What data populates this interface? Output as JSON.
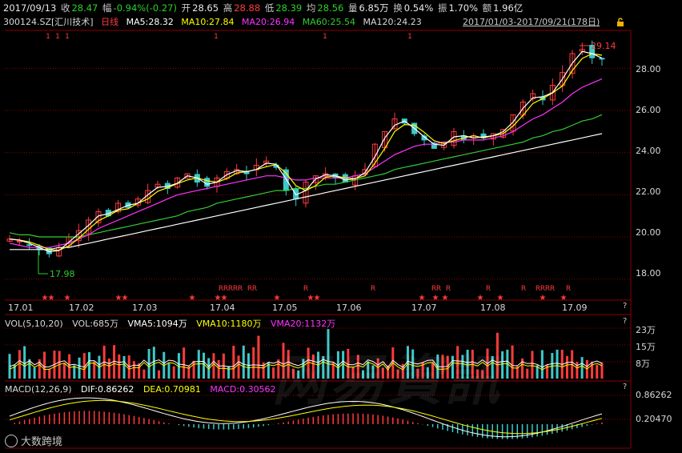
{
  "quote": {
    "date": "2017/09/13",
    "close_label": "收",
    "close": "28.47",
    "change_label": "幅",
    "change": "-0.94%(-0.27)",
    "open_label": "开",
    "open": "28.65",
    "high_label": "高",
    "high": "28.88",
    "low_label": "低",
    "low": "28.39",
    "avg_label": "均",
    "avg": "28.56",
    "volume_label": "量",
    "volume": "6.85万",
    "turnover_label": "换",
    "turnover": "0.54%",
    "amplitude_label": "振",
    "amplitude": "1.70%",
    "amount_label": "额",
    "amount": "1.96亿"
  },
  "info": {
    "code": "300124.SZ",
    "name": "[汇川技术]",
    "period": "日线",
    "ma5": "MA5:28.32",
    "ma10": "MA10:27.84",
    "ma20": "MA20:26.94",
    "ma60": "MA60:25.54",
    "ma120": "MA120:24.23",
    "date_range": "2017/01/03-2017/09/21(178日)"
  },
  "price_axis": [
    "28.00",
    "26.00",
    "24.00",
    "22.00",
    "20.00",
    "18.00"
  ],
  "annotations": {
    "high": "29.14",
    "low": "17.98"
  },
  "months": [
    "17.01",
    "17.02",
    "17.03",
    "17.04",
    "17.05",
    "17.06",
    "17.07",
    "17.08",
    "17.09"
  ],
  "volume": {
    "title": "VOL(5,10,20)",
    "vol": "VOL:685万",
    "vma5": "VMA5:1094万",
    "vma10": "VMA10:1180万",
    "vma20": "VMA20:1132万",
    "axis": [
      "23万",
      "15万",
      "8万"
    ],
    "help": "?"
  },
  "macd": {
    "title": "MACD(12,26,9)",
    "dif": "DIF:0.86262",
    "dea": "DEA:0.70981",
    "macd": "MACD:0.30562",
    "axis": [
      "0.86262",
      "0.20470"
    ],
    "help": "?"
  },
  "chart_help": "?",
  "brand": "大数跨境",
  "watermark": "网易資訊",
  "colors": {
    "up": "#ff3b3b",
    "down": "#3ec9c9",
    "ma5": "#ffffff",
    "ma10": "#ffff00",
    "ma20": "#ff33ff",
    "ma60": "#33cc33",
    "ma120": "#ffffff",
    "grid": "#8b0000"
  },
  "chart_data": {
    "type": "candlestick",
    "ylim": [
      17.0,
      29.8
    ],
    "closes": [
      19.9,
      19.8,
      19.6,
      19.4,
      19.2,
      19.5,
      20.0,
      20.3,
      20.8,
      21.2,
      21.0,
      21.6,
      21.4,
      21.8,
      22.2,
      22.5,
      22.3,
      22.8,
      23.0,
      22.6,
      22.4,
      22.8,
      23.1,
      23.2,
      23.0,
      23.4,
      23.6,
      23.3,
      22.2,
      21.8,
      22.6,
      22.9,
      23.0,
      22.8,
      22.6,
      22.9,
      23.2,
      24.4,
      25.0,
      25.6,
      25.4,
      24.9,
      24.6,
      24.2,
      24.5,
      25.0,
      24.6,
      24.8,
      24.7,
      24.9,
      25.1,
      25.8,
      26.4,
      26.8,
      26.5,
      27.2,
      27.8,
      28.7,
      28.9,
      28.5,
      28.47
    ],
    "ma20": [
      19.7,
      19.6,
      19.5,
      19.5,
      19.5,
      19.6,
      19.7,
      19.9,
      20.1,
      20.4,
      20.6,
      20.8,
      21.0,
      21.2,
      21.4,
      21.6,
      21.8,
      22.0,
      22.1,
      22.2,
      22.3,
      22.4,
      22.5,
      22.6,
      22.7,
      22.8,
      22.9,
      22.9,
      22.8,
      22.7,
      22.7,
      22.8,
      22.8,
      22.8,
      22.8,
      22.9,
      23.0,
      23.3,
      23.6,
      23.9,
      24.1,
      24.3,
      24.4,
      24.4,
      24.5,
      24.5,
      24.6,
      24.6,
      24.6,
      24.7,
      24.8,
      25.0,
      25.3,
      25.6,
      25.8,
      26.1,
      26.4,
      26.8,
      27.1,
      27.3,
      27.5
    ],
    "ma60": [
      20.2,
      20.1,
      20.1,
      20.0,
      20.0,
      20.0,
      20.0,
      20.0,
      20.1,
      20.2,
      20.3,
      20.4,
      20.5,
      20.6,
      20.7,
      20.8,
      20.9,
      21.0,
      21.2,
      21.3,
      21.4,
      21.6,
      21.7,
      21.8,
      21.9,
      22.0,
      22.1,
      22.2,
      22.2,
      22.3,
      22.3,
      22.4,
      22.5,
      22.5,
      22.6,
      22.7,
      22.8,
      22.9,
      23.0,
      23.2,
      23.3,
      23.4,
      23.5,
      23.6,
      23.7,
      23.8,
      23.9,
      24.0,
      24.1,
      24.2,
      24.3,
      24.4,
      24.5,
      24.7,
      24.8,
      25.0,
      25.1,
      25.3,
      25.5,
      25.6,
      25.8
    ],
    "ma120": [
      19.4,
      19.4,
      19.4,
      19.4,
      19.4,
      19.5,
      19.5,
      19.6,
      19.7,
      19.8,
      19.9,
      20.0,
      20.1,
      20.2,
      20.3,
      20.4,
      20.5,
      20.6,
      20.7,
      20.8,
      20.9,
      21.0,
      21.1,
      21.2,
      21.3,
      21.4,
      21.5,
      21.6,
      21.7,
      21.8,
      21.9,
      22.0,
      22.1,
      22.2,
      22.3,
      22.4,
      22.5,
      22.6,
      22.7,
      22.8,
      22.9,
      23.0,
      23.1,
      23.2,
      23.3,
      23.4,
      23.5,
      23.6,
      23.7,
      23.8,
      23.9,
      24.0,
      24.1,
      24.2,
      24.3,
      24.4,
      24.5,
      24.6,
      24.7,
      24.8,
      24.9
    ]
  }
}
